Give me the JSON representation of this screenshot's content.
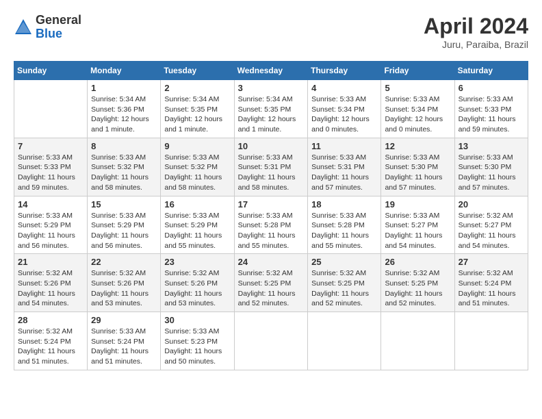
{
  "header": {
    "logo_general": "General",
    "logo_blue": "Blue",
    "month_title": "April 2024",
    "location": "Juru, Paraiba, Brazil"
  },
  "columns": [
    "Sunday",
    "Monday",
    "Tuesday",
    "Wednesday",
    "Thursday",
    "Friday",
    "Saturday"
  ],
  "weeks": [
    [
      {
        "day": "",
        "sunrise": "",
        "sunset": "",
        "daylight": ""
      },
      {
        "day": "1",
        "sunrise": "Sunrise: 5:34 AM",
        "sunset": "Sunset: 5:36 PM",
        "daylight": "Daylight: 12 hours and 1 minute."
      },
      {
        "day": "2",
        "sunrise": "Sunrise: 5:34 AM",
        "sunset": "Sunset: 5:35 PM",
        "daylight": "Daylight: 12 hours and 1 minute."
      },
      {
        "day": "3",
        "sunrise": "Sunrise: 5:34 AM",
        "sunset": "Sunset: 5:35 PM",
        "daylight": "Daylight: 12 hours and 1 minute."
      },
      {
        "day": "4",
        "sunrise": "Sunrise: 5:33 AM",
        "sunset": "Sunset: 5:34 PM",
        "daylight": "Daylight: 12 hours and 0 minutes."
      },
      {
        "day": "5",
        "sunrise": "Sunrise: 5:33 AM",
        "sunset": "Sunset: 5:34 PM",
        "daylight": "Daylight: 12 hours and 0 minutes."
      },
      {
        "day": "6",
        "sunrise": "Sunrise: 5:33 AM",
        "sunset": "Sunset: 5:33 PM",
        "daylight": "Daylight: 11 hours and 59 minutes."
      }
    ],
    [
      {
        "day": "7",
        "sunrise": "Sunrise: 5:33 AM",
        "sunset": "Sunset: 5:33 PM",
        "daylight": "Daylight: 11 hours and 59 minutes."
      },
      {
        "day": "8",
        "sunrise": "Sunrise: 5:33 AM",
        "sunset": "Sunset: 5:32 PM",
        "daylight": "Daylight: 11 hours and 58 minutes."
      },
      {
        "day": "9",
        "sunrise": "Sunrise: 5:33 AM",
        "sunset": "Sunset: 5:32 PM",
        "daylight": "Daylight: 11 hours and 58 minutes."
      },
      {
        "day": "10",
        "sunrise": "Sunrise: 5:33 AM",
        "sunset": "Sunset: 5:31 PM",
        "daylight": "Daylight: 11 hours and 58 minutes."
      },
      {
        "day": "11",
        "sunrise": "Sunrise: 5:33 AM",
        "sunset": "Sunset: 5:31 PM",
        "daylight": "Daylight: 11 hours and 57 minutes."
      },
      {
        "day": "12",
        "sunrise": "Sunrise: 5:33 AM",
        "sunset": "Sunset: 5:30 PM",
        "daylight": "Daylight: 11 hours and 57 minutes."
      },
      {
        "day": "13",
        "sunrise": "Sunrise: 5:33 AM",
        "sunset": "Sunset: 5:30 PM",
        "daylight": "Daylight: 11 hours and 57 minutes."
      }
    ],
    [
      {
        "day": "14",
        "sunrise": "Sunrise: 5:33 AM",
        "sunset": "Sunset: 5:29 PM",
        "daylight": "Daylight: 11 hours and 56 minutes."
      },
      {
        "day": "15",
        "sunrise": "Sunrise: 5:33 AM",
        "sunset": "Sunset: 5:29 PM",
        "daylight": "Daylight: 11 hours and 56 minutes."
      },
      {
        "day": "16",
        "sunrise": "Sunrise: 5:33 AM",
        "sunset": "Sunset: 5:29 PM",
        "daylight": "Daylight: 11 hours and 55 minutes."
      },
      {
        "day": "17",
        "sunrise": "Sunrise: 5:33 AM",
        "sunset": "Sunset: 5:28 PM",
        "daylight": "Daylight: 11 hours and 55 minutes."
      },
      {
        "day": "18",
        "sunrise": "Sunrise: 5:33 AM",
        "sunset": "Sunset: 5:28 PM",
        "daylight": "Daylight: 11 hours and 55 minutes."
      },
      {
        "day": "19",
        "sunrise": "Sunrise: 5:33 AM",
        "sunset": "Sunset: 5:27 PM",
        "daylight": "Daylight: 11 hours and 54 minutes."
      },
      {
        "day": "20",
        "sunrise": "Sunrise: 5:32 AM",
        "sunset": "Sunset: 5:27 PM",
        "daylight": "Daylight: 11 hours and 54 minutes."
      }
    ],
    [
      {
        "day": "21",
        "sunrise": "Sunrise: 5:32 AM",
        "sunset": "Sunset: 5:26 PM",
        "daylight": "Daylight: 11 hours and 54 minutes."
      },
      {
        "day": "22",
        "sunrise": "Sunrise: 5:32 AM",
        "sunset": "Sunset: 5:26 PM",
        "daylight": "Daylight: 11 hours and 53 minutes."
      },
      {
        "day": "23",
        "sunrise": "Sunrise: 5:32 AM",
        "sunset": "Sunset: 5:26 PM",
        "daylight": "Daylight: 11 hours and 53 minutes."
      },
      {
        "day": "24",
        "sunrise": "Sunrise: 5:32 AM",
        "sunset": "Sunset: 5:25 PM",
        "daylight": "Daylight: 11 hours and 52 minutes."
      },
      {
        "day": "25",
        "sunrise": "Sunrise: 5:32 AM",
        "sunset": "Sunset: 5:25 PM",
        "daylight": "Daylight: 11 hours and 52 minutes."
      },
      {
        "day": "26",
        "sunrise": "Sunrise: 5:32 AM",
        "sunset": "Sunset: 5:25 PM",
        "daylight": "Daylight: 11 hours and 52 minutes."
      },
      {
        "day": "27",
        "sunrise": "Sunrise: 5:32 AM",
        "sunset": "Sunset: 5:24 PM",
        "daylight": "Daylight: 11 hours and 51 minutes."
      }
    ],
    [
      {
        "day": "28",
        "sunrise": "Sunrise: 5:32 AM",
        "sunset": "Sunset: 5:24 PM",
        "daylight": "Daylight: 11 hours and 51 minutes."
      },
      {
        "day": "29",
        "sunrise": "Sunrise: 5:33 AM",
        "sunset": "Sunset: 5:24 PM",
        "daylight": "Daylight: 11 hours and 51 minutes."
      },
      {
        "day": "30",
        "sunrise": "Sunrise: 5:33 AM",
        "sunset": "Sunset: 5:23 PM",
        "daylight": "Daylight: 11 hours and 50 minutes."
      },
      {
        "day": "",
        "sunrise": "",
        "sunset": "",
        "daylight": ""
      },
      {
        "day": "",
        "sunrise": "",
        "sunset": "",
        "daylight": ""
      },
      {
        "day": "",
        "sunrise": "",
        "sunset": "",
        "daylight": ""
      },
      {
        "day": "",
        "sunrise": "",
        "sunset": "",
        "daylight": ""
      }
    ]
  ]
}
